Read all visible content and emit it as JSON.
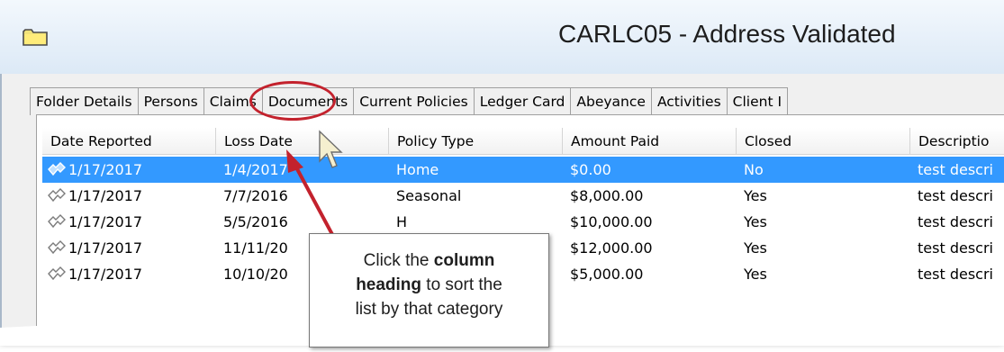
{
  "window": {
    "title": "CARLC05 - Address Validated",
    "folder_icon": "folder-icon"
  },
  "tabs": [
    {
      "label": "Folder Details"
    },
    {
      "label": "Persons"
    },
    {
      "label": "Claims"
    },
    {
      "label": "Documents"
    },
    {
      "label": "Current Policies"
    },
    {
      "label": "Ledger Card"
    },
    {
      "label": "Abeyance"
    },
    {
      "label": "Activities"
    },
    {
      "label": "Client I"
    }
  ],
  "columns": [
    "Date Reported",
    "Loss Date",
    "Policy Type",
    "Amount Paid",
    "Closed",
    "Descriptio"
  ],
  "rows": [
    {
      "date_reported": "1/17/2017",
      "loss_date": "1/4/2017",
      "policy_type": "Home",
      "amount_paid": "$0.00",
      "closed": "No",
      "description": "test descri",
      "selected": true
    },
    {
      "date_reported": "1/17/2017",
      "loss_date": "7/7/2016",
      "policy_type": "Seasonal",
      "amount_paid": "$8,000.00",
      "closed": "Yes",
      "description": "test descri"
    },
    {
      "date_reported": "1/17/2017",
      "loss_date": "5/5/2016",
      "policy_type": "H",
      "amount_paid": "$10,000.00",
      "closed": "Yes",
      "description": "test descri"
    },
    {
      "date_reported": "1/17/2017",
      "loss_date": "11/11/20",
      "policy_type": "",
      "amount_paid": "$12,000.00",
      "closed": "Yes",
      "description": "test descri"
    },
    {
      "date_reported": "1/17/2017",
      "loss_date": "10/10/20",
      "policy_type": "",
      "amount_paid": "$5,000.00",
      "closed": "Yes",
      "description": "test descri"
    }
  ],
  "callout": {
    "line1_pre": "Click the ",
    "line1_bold": "column",
    "line2_bold": "heading",
    "line2_post": " to sort the",
    "line3": "list by that category"
  },
  "colors": {
    "selection": "#3399ff",
    "annotation_red": "#c3222d"
  }
}
